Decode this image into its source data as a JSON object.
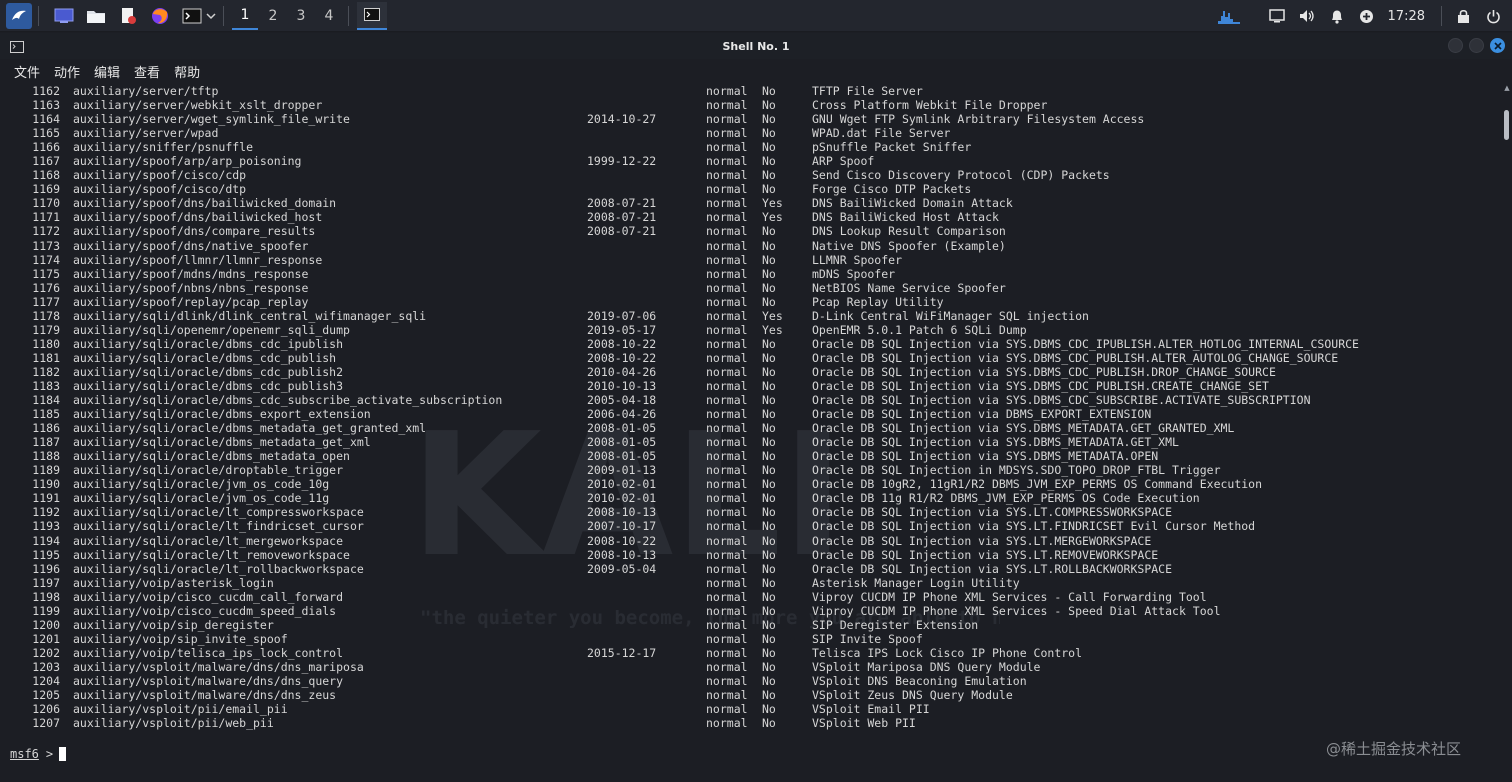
{
  "taskbar": {
    "workspaces": [
      "1",
      "2",
      "3",
      "4"
    ],
    "clock": "17:28"
  },
  "window": {
    "title": "Shell No. 1"
  },
  "menu": [
    "文件",
    "动作",
    "编辑",
    "查看",
    "帮助"
  ],
  "modules": [
    [
      "1162",
      "auxiliary/server/tftp",
      "",
      "normal",
      "No",
      "TFTP File Server"
    ],
    [
      "1163",
      "auxiliary/server/webkit_xslt_dropper",
      "",
      "normal",
      "No",
      "Cross Platform Webkit File Dropper"
    ],
    [
      "1164",
      "auxiliary/server/wget_symlink_file_write",
      "2014-10-27",
      "normal",
      "No",
      "GNU Wget FTP Symlink Arbitrary Filesystem Access"
    ],
    [
      "1165",
      "auxiliary/server/wpad",
      "",
      "normal",
      "No",
      "WPAD.dat File Server"
    ],
    [
      "1166",
      "auxiliary/sniffer/psnuffle",
      "",
      "normal",
      "No",
      "pSnuffle Packet Sniffer"
    ],
    [
      "1167",
      "auxiliary/spoof/arp/arp_poisoning",
      "1999-12-22",
      "normal",
      "No",
      "ARP Spoof"
    ],
    [
      "1168",
      "auxiliary/spoof/cisco/cdp",
      "",
      "normal",
      "No",
      "Send Cisco Discovery Protocol (CDP) Packets"
    ],
    [
      "1169",
      "auxiliary/spoof/cisco/dtp",
      "",
      "normal",
      "No",
      "Forge Cisco DTP Packets"
    ],
    [
      "1170",
      "auxiliary/spoof/dns/bailiwicked_domain",
      "2008-07-21",
      "normal",
      "Yes",
      "DNS BailiWicked Domain Attack"
    ],
    [
      "1171",
      "auxiliary/spoof/dns/bailiwicked_host",
      "2008-07-21",
      "normal",
      "Yes",
      "DNS BailiWicked Host Attack"
    ],
    [
      "1172",
      "auxiliary/spoof/dns/compare_results",
      "2008-07-21",
      "normal",
      "No",
      "DNS Lookup Result Comparison"
    ],
    [
      "1173",
      "auxiliary/spoof/dns/native_spoofer",
      "",
      "normal",
      "No",
      "Native DNS Spoofer (Example)"
    ],
    [
      "1174",
      "auxiliary/spoof/llmnr/llmnr_response",
      "",
      "normal",
      "No",
      "LLMNR Spoofer"
    ],
    [
      "1175",
      "auxiliary/spoof/mdns/mdns_response",
      "",
      "normal",
      "No",
      "mDNS Spoofer"
    ],
    [
      "1176",
      "auxiliary/spoof/nbns/nbns_response",
      "",
      "normal",
      "No",
      "NetBIOS Name Service Spoofer"
    ],
    [
      "1177",
      "auxiliary/spoof/replay/pcap_replay",
      "",
      "normal",
      "No",
      "Pcap Replay Utility"
    ],
    [
      "1178",
      "auxiliary/sqli/dlink/dlink_central_wifimanager_sqli",
      "2019-07-06",
      "normal",
      "Yes",
      "D-Link Central WiFiManager SQL injection"
    ],
    [
      "1179",
      "auxiliary/sqli/openemr/openemr_sqli_dump",
      "2019-05-17",
      "normal",
      "Yes",
      "OpenEMR 5.0.1 Patch 6 SQLi Dump"
    ],
    [
      "1180",
      "auxiliary/sqli/oracle/dbms_cdc_ipublish",
      "2008-10-22",
      "normal",
      "No",
      "Oracle DB SQL Injection via SYS.DBMS_CDC_IPUBLISH.ALTER_HOTLOG_INTERNAL_CSOURCE"
    ],
    [
      "1181",
      "auxiliary/sqli/oracle/dbms_cdc_publish",
      "2008-10-22",
      "normal",
      "No",
      "Oracle DB SQL Injection via SYS.DBMS_CDC_PUBLISH.ALTER_AUTOLOG_CHANGE_SOURCE"
    ],
    [
      "1182",
      "auxiliary/sqli/oracle/dbms_cdc_publish2",
      "2010-04-26",
      "normal",
      "No",
      "Oracle DB SQL Injection via SYS.DBMS_CDC_PUBLISH.DROP_CHANGE_SOURCE"
    ],
    [
      "1183",
      "auxiliary/sqli/oracle/dbms_cdc_publish3",
      "2010-10-13",
      "normal",
      "No",
      "Oracle DB SQL Injection via SYS.DBMS_CDC_PUBLISH.CREATE_CHANGE_SET"
    ],
    [
      "1184",
      "auxiliary/sqli/oracle/dbms_cdc_subscribe_activate_subscription",
      "2005-04-18",
      "normal",
      "No",
      "Oracle DB SQL Injection via SYS.DBMS_CDC_SUBSCRIBE.ACTIVATE_SUBSCRIPTION"
    ],
    [
      "1185",
      "auxiliary/sqli/oracle/dbms_export_extension",
      "2006-04-26",
      "normal",
      "No",
      "Oracle DB SQL Injection via DBMS_EXPORT_EXTENSION"
    ],
    [
      "1186",
      "auxiliary/sqli/oracle/dbms_metadata_get_granted_xml",
      "2008-01-05",
      "normal",
      "No",
      "Oracle DB SQL Injection via SYS.DBMS_METADATA.GET_GRANTED_XML"
    ],
    [
      "1187",
      "auxiliary/sqli/oracle/dbms_metadata_get_xml",
      "2008-01-05",
      "normal",
      "No",
      "Oracle DB SQL Injection via SYS.DBMS_METADATA.GET_XML"
    ],
    [
      "1188",
      "auxiliary/sqli/oracle/dbms_metadata_open",
      "2008-01-05",
      "normal",
      "No",
      "Oracle DB SQL Injection via SYS.DBMS_METADATA.OPEN"
    ],
    [
      "1189",
      "auxiliary/sqli/oracle/droptable_trigger",
      "2009-01-13",
      "normal",
      "No",
      "Oracle DB SQL Injection in MDSYS.SDO_TOPO_DROP_FTBL Trigger"
    ],
    [
      "1190",
      "auxiliary/sqli/oracle/jvm_os_code_10g",
      "2010-02-01",
      "normal",
      "No",
      "Oracle DB 10gR2, 11gR1/R2 DBMS_JVM_EXP_PERMS OS Command Execution"
    ],
    [
      "1191",
      "auxiliary/sqli/oracle/jvm_os_code_11g",
      "2010-02-01",
      "normal",
      "No",
      "Oracle DB 11g R1/R2 DBMS_JVM_EXP_PERMS OS Code Execution"
    ],
    [
      "1192",
      "auxiliary/sqli/oracle/lt_compressworkspace",
      "2008-10-13",
      "normal",
      "No",
      "Oracle DB SQL Injection via SYS.LT.COMPRESSWORKSPACE"
    ],
    [
      "1193",
      "auxiliary/sqli/oracle/lt_findricset_cursor",
      "2007-10-17",
      "normal",
      "No",
      "Oracle DB SQL Injection via SYS.LT.FINDRICSET Evil Cursor Method"
    ],
    [
      "1194",
      "auxiliary/sqli/oracle/lt_mergeworkspace",
      "2008-10-22",
      "normal",
      "No",
      "Oracle DB SQL Injection via SYS.LT.MERGEWORKSPACE"
    ],
    [
      "1195",
      "auxiliary/sqli/oracle/lt_removeworkspace",
      "2008-10-13",
      "normal",
      "No",
      "Oracle DB SQL Injection via SYS.LT.REMOVEWORKSPACE"
    ],
    [
      "1196",
      "auxiliary/sqli/oracle/lt_rollbackworkspace",
      "2009-05-04",
      "normal",
      "No",
      "Oracle DB SQL Injection via SYS.LT.ROLLBACKWORKSPACE"
    ],
    [
      "1197",
      "auxiliary/voip/asterisk_login",
      "",
      "normal",
      "No",
      "Asterisk Manager Login Utility"
    ],
    [
      "1198",
      "auxiliary/voip/cisco_cucdm_call_forward",
      "",
      "normal",
      "No",
      "Viproy CUCDM IP Phone XML Services - Call Forwarding Tool"
    ],
    [
      "1199",
      "auxiliary/voip/cisco_cucdm_speed_dials",
      "",
      "normal",
      "No",
      "Viproy CUCDM IP Phone XML Services - Speed Dial Attack Tool"
    ],
    [
      "1200",
      "auxiliary/voip/sip_deregister",
      "",
      "normal",
      "No",
      "SIP Deregister Extension"
    ],
    [
      "1201",
      "auxiliary/voip/sip_invite_spoof",
      "",
      "normal",
      "No",
      "SIP Invite Spoof"
    ],
    [
      "1202",
      "auxiliary/voip/telisca_ips_lock_control",
      "2015-12-17",
      "normal",
      "No",
      "Telisca IPS Lock Cisco IP Phone Control"
    ],
    [
      "1203",
      "auxiliary/vsploit/malware/dns/dns_mariposa",
      "",
      "normal",
      "No",
      "VSploit Mariposa DNS Query Module"
    ],
    [
      "1204",
      "auxiliary/vsploit/malware/dns/dns_query",
      "",
      "normal",
      "No",
      "VSploit DNS Beaconing Emulation"
    ],
    [
      "1205",
      "auxiliary/vsploit/malware/dns/dns_zeus",
      "",
      "normal",
      "No",
      "VSploit Zeus DNS Query Module"
    ],
    [
      "1206",
      "auxiliary/vsploit/pii/email_pii",
      "",
      "normal",
      "No",
      "VSploit Email PII"
    ],
    [
      "1207",
      "auxiliary/vsploit/pii/web_pii",
      "",
      "normal",
      "No",
      "VSploit Web PII"
    ]
  ],
  "prompt": {
    "name": "msf6",
    "symbol": ">"
  },
  "watermark": {
    "logo_text": "KALI",
    "tagline": "\"the quieter you become, the more you are able to hear\""
  },
  "overlay": {
    "juejin": "@稀土掘金技术社区"
  },
  "colors": {
    "accent": "#3f86d8",
    "terminal_bg": "#1c1e24",
    "taskbar_bg": "#23262e"
  },
  "icons": {
    "kali_menu": "kali-dragon-icon",
    "desktop": "desktop-icon",
    "files": "folder-icon",
    "editor": "text-editor-icon",
    "browser": "firefox-icon",
    "terminal": "terminal-icon",
    "tray": [
      "network-graph-icon",
      "monitor-icon",
      "volume-icon",
      "bell-icon",
      "update-icon",
      "lock-icon",
      "power-icon"
    ]
  }
}
